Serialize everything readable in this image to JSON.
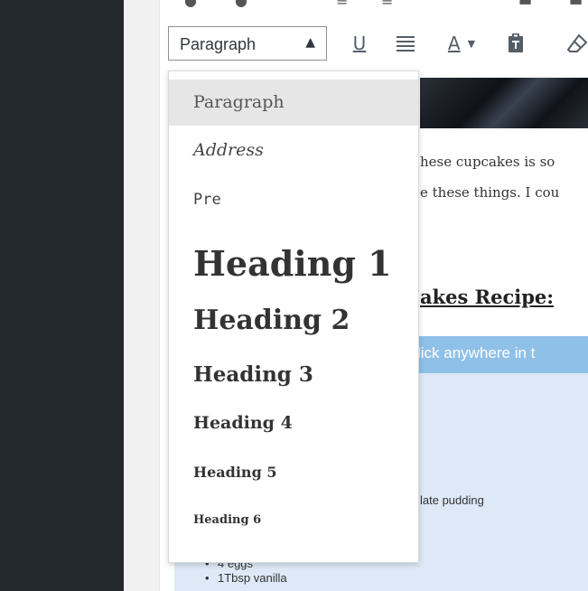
{
  "toolbar": {
    "format_select_value": "Paragraph",
    "format_caret": "▲",
    "underline_glyph": "U",
    "text_color_glyph": "A",
    "text_color_arrow": "▼",
    "icons": [
      "underline-icon",
      "justify-icon",
      "text-color-icon",
      "paste-as-text-icon",
      "clear-formatting-icon"
    ]
  },
  "format_menu": {
    "items": [
      {
        "label": "Paragraph",
        "selected": true
      },
      {
        "label": "Address"
      },
      {
        "label": "Pre"
      },
      {
        "label": "Heading 1"
      },
      {
        "label": "Heading 2"
      },
      {
        "label": "Heading 3"
      },
      {
        "label": "Heading 4"
      },
      {
        "label": "Heading 5"
      },
      {
        "label": "Heading 6"
      }
    ]
  },
  "content": {
    "line1": "hese cupcakes is so",
    "line2": "e these things. I cou",
    "recipe_heading": "akes Recipe:",
    "notice": "lick anywhere in t",
    "pudding_line": "late pudding",
    "ingredients": [
      "4 eggs",
      "1Tbsp vanilla"
    ]
  },
  "colors": {
    "admin_sidebar": "#23282d",
    "menu_highlight": "#e6e6e6",
    "notice_bar": "#8fc0e8",
    "recipe_box": "#dde9f6"
  }
}
